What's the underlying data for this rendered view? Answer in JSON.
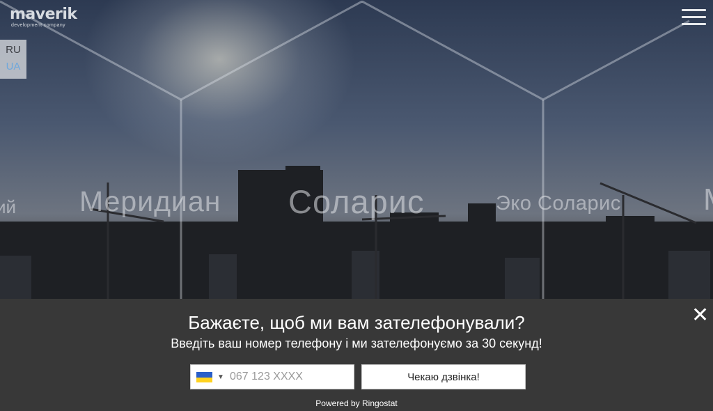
{
  "logo": {
    "name": "maverik",
    "tagline": "development company"
  },
  "header": {
    "menu_icon": "hamburger-menu-icon"
  },
  "languages": [
    {
      "code": "RU",
      "active": false
    },
    {
      "code": "UA",
      "active": true
    }
  ],
  "projects": [
    {
      "label": "ий"
    },
    {
      "label": "Меридиан"
    },
    {
      "label": "Соларис"
    },
    {
      "label": "Эко Соларис"
    },
    {
      "label": "М"
    }
  ],
  "callback": {
    "title": "Бажаєте, щоб ми вам зателефонували?",
    "subtitle": "Введіть ваш номер телефону і ми зателефонуємо за 30 секунд!",
    "phone_placeholder": "067 123 XXXX",
    "phone_value": "",
    "country_flag": "ukraine-flag-icon",
    "button_label": "Чекаю дзвінка!",
    "powered_by": "Powered by Ringostat",
    "close_icon": "close-icon"
  },
  "colors": {
    "popup_bg": "#383838",
    "active_lang": "#6fa8dc",
    "flag_blue": "#2a5fc9",
    "flag_yellow": "#ffd21f"
  }
}
